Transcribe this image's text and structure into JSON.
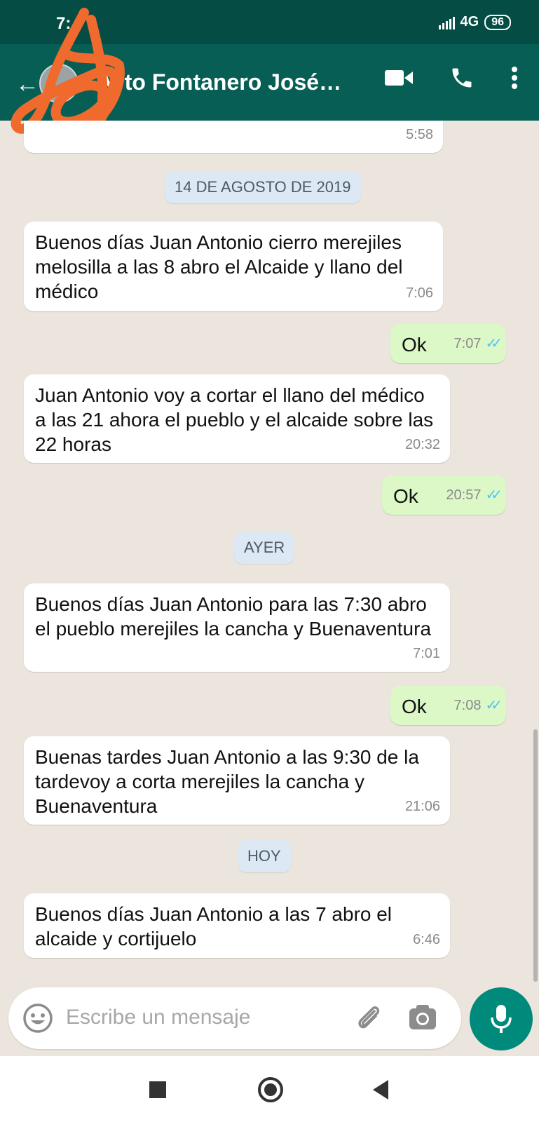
{
  "status": {
    "time": "7:",
    "network": "4G",
    "battery": "96"
  },
  "header": {
    "contact_name": "Ayto Fontanero José…",
    "back_icon": "arrow-back-icon",
    "video_icon": "video-call-icon",
    "call_icon": "phone-icon",
    "menu_icon": "more-vert-icon"
  },
  "chat": {
    "partial_message_time": "5:58",
    "date_1": "14 DE AGOSTO DE 2019",
    "msg_1": {
      "text": "Buenos días Juan Antonio cierro merejiles melosilla a las 8 abro el Alcaide y llano del médico",
      "time": "7:06"
    },
    "msg_2": {
      "text": "Ok",
      "time": "7:07"
    },
    "msg_3": {
      "text": "Juan Antonio voy a cortar el llano del médico a las 21 ahora el pueblo y el alcaide sobre las 22 horas",
      "time": "20:32"
    },
    "msg_4": {
      "text": "Ok",
      "time": "20:57"
    },
    "date_2": "AYER",
    "msg_5": {
      "text": "Buenos días Juan Antonio para las 7:30 abro el pueblo merejiles la cancha y Buenaventura",
      "time": "7:01"
    },
    "msg_6": {
      "text": "Ok",
      "time": "7:08"
    },
    "msg_7": {
      "text": "Buenas tardes Juan Antonio a las 9:30 de la tardevoy a corta merejiles la cancha y Buenaventura",
      "time": "21:06"
    },
    "date_3": "HOY",
    "msg_8": {
      "text": "Buenos días Juan Antonio a las 7 abro el alcaide y cortijuelo",
      "time": "6:46"
    }
  },
  "composer": {
    "placeholder": "Escribe un mensaje"
  },
  "colors": {
    "header": "#075e54",
    "statusbar": "#054d44",
    "outgoing_bubble": "#dcf8c6",
    "incoming_bubble": "#ffffff",
    "read_ticks": "#4fc3f7",
    "mic_button": "#008a7c"
  }
}
